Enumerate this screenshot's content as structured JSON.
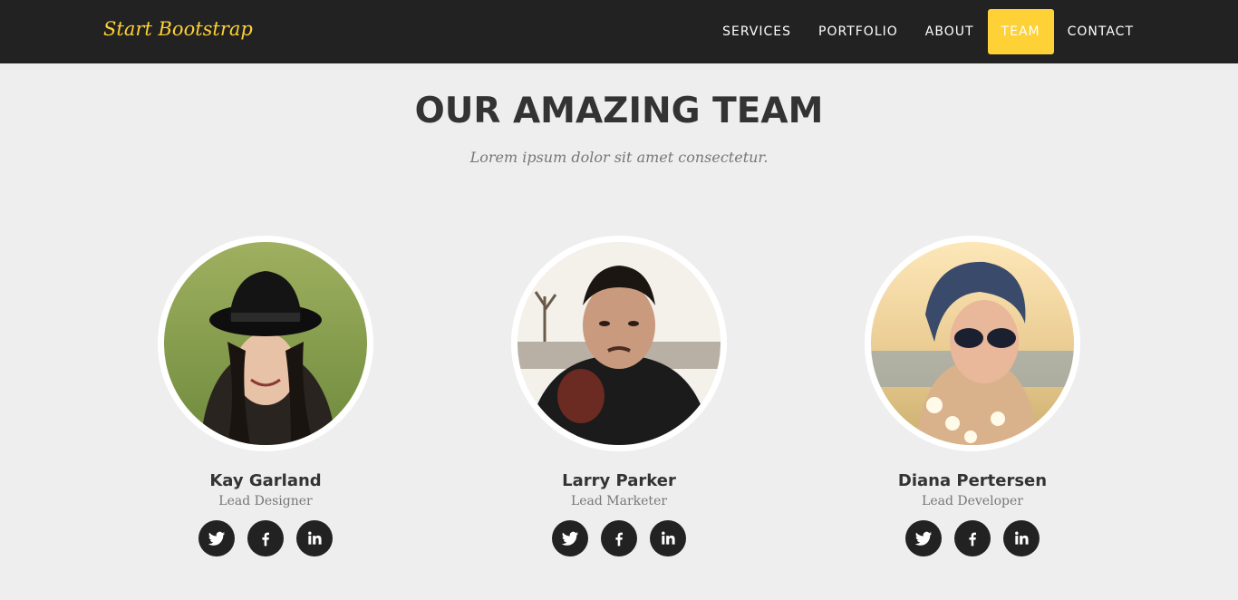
{
  "brand": "Start Bootstrap",
  "nav": {
    "items": [
      {
        "label": "SERVICES"
      },
      {
        "label": "PORTFOLIO"
      },
      {
        "label": "ABOUT"
      },
      {
        "label": "TEAM"
      },
      {
        "label": "CONTACT"
      }
    ],
    "active": "TEAM"
  },
  "section": {
    "title": "OUR AMAZING TEAM",
    "subtitle": "Lorem ipsum dolor sit amet consectetur."
  },
  "team": [
    {
      "name": "Kay Garland",
      "role": "Lead Designer",
      "socials": [
        "twitter-icon",
        "facebook-icon",
        "linkedin-icon"
      ]
    },
    {
      "name": "Larry Parker",
      "role": "Lead Marketer",
      "socials": [
        "twitter-icon",
        "facebook-icon",
        "linkedin-icon"
      ]
    },
    {
      "name": "Diana Pertersen",
      "role": "Lead Developer",
      "socials": [
        "twitter-icon",
        "facebook-icon",
        "linkedin-icon"
      ]
    }
  ],
  "colors": {
    "accent": "#fed136",
    "navbar": "#222222",
    "background": "#eeeeee",
    "heading": "#333333",
    "muted": "#777777"
  }
}
